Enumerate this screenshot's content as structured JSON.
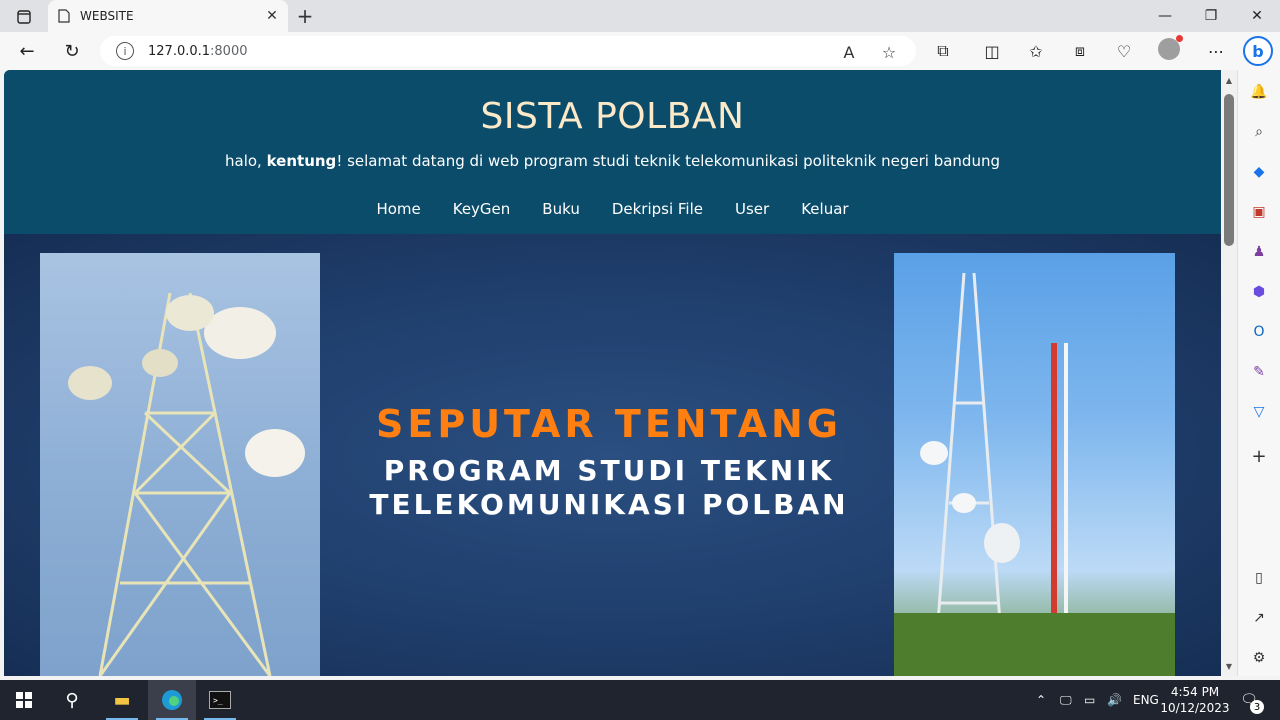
{
  "browser": {
    "tab_title": "WEBSITE",
    "url_host": "127.0.0.1",
    "url_port": ":8000"
  },
  "site": {
    "title": "SISTA POLBAN",
    "greeting_prefix": "halo, ",
    "greeting_user": "kentung",
    "greeting_suffix": "! selamat datang di web program studi teknik telekomunikasi politeknik negeri bandung",
    "nav": [
      "Home",
      "KeyGen",
      "Buku",
      "Dekripsi File",
      "User",
      "Keluar"
    ]
  },
  "hero": {
    "headline": "SEPUTAR TENTANG",
    "sub_line_1": "PROGRAM STUDI TEKNIK",
    "sub_line_2": "TELEKOMUNIKASI POLBAN"
  },
  "taskbar": {
    "language": "ENG",
    "time": "4:54 PM",
    "date": "10/12/2023",
    "notification_count": "3"
  },
  "colors": {
    "header_bg": "#0b4c6b",
    "title_color": "#fbe9c8",
    "hero_accent": "#ff7f11"
  }
}
